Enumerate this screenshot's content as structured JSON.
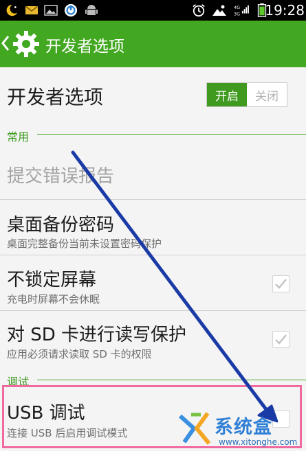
{
  "status_bar": {
    "time": "19:28",
    "icons": [
      "moon-icon",
      "mail-icon",
      "image-icon",
      "sync-icon",
      "android-icon",
      "alarm-icon",
      "weather-icon",
      "signal-icon",
      "battery-icon"
    ],
    "network_labels": [
      "4G",
      "3G"
    ]
  },
  "action_bar": {
    "title": "开发者选项",
    "icon": "gear-icon",
    "back_icon": "chevron-left-icon",
    "color": "#42a821"
  },
  "master_switch": {
    "title": "开发者选项",
    "on_label": "开启",
    "off_label": "关闭",
    "state": "on"
  },
  "categories": {
    "common": "常用",
    "debug": "调试"
  },
  "items": {
    "bug_report": {
      "title": "提交错误报告",
      "enabled": false
    },
    "backup_password": {
      "title": "桌面备份密码",
      "summary": "桌面完整备份当前未设置密码保护"
    },
    "stay_awake": {
      "title": "不锁定屏幕",
      "summary": "充电时屏幕不会休眠",
      "checked": true
    },
    "sd_protect": {
      "title": "对 SD 卡进行读写保护",
      "summary": "应用必须请求读取 SD 卡的权限",
      "checked": true
    },
    "usb_debug": {
      "title": "USB 调试",
      "summary": "连接 USB 后启用调试模式",
      "checked": false
    }
  },
  "annotation": {
    "highlight_color": "#f06aa0",
    "arrow_color": "#1a3aa6"
  },
  "watermark": {
    "text": "系统盒",
    "url": "www.xitonghe.com"
  }
}
